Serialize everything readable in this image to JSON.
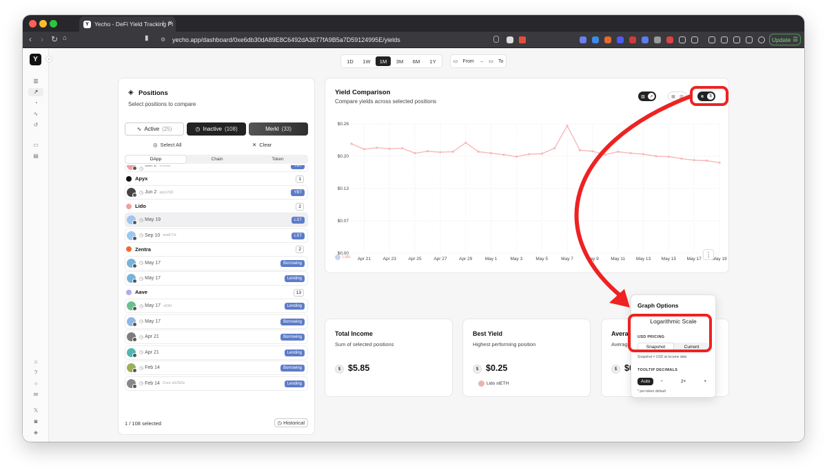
{
  "browser": {
    "tab_title": "Yecho - DeFi Yield Tracking Pl",
    "url": "yecho.app/dashboard/0xe6db30dA89E8C6492dA3677fA9B5a7D59124995E/yields",
    "update_label": "Update",
    "favicon_letter": "Y"
  },
  "app": {
    "logo_letter": "Y"
  },
  "range": {
    "options": [
      "1D",
      "1W",
      "1M",
      "3M",
      "6M",
      "1Y"
    ],
    "selected": "1M",
    "from_label": "From",
    "arrow": "→",
    "to_label": "To"
  },
  "positions": {
    "title": "Positions",
    "subtitle": "Select positions to compare",
    "filters": [
      {
        "label": "Active",
        "count": "(25)"
      },
      {
        "label": "Inactive",
        "count": "(108)"
      },
      {
        "label": "Merkl",
        "count": "(33)"
      }
    ],
    "select_all": "Select All",
    "clear": "Clear",
    "tabs": [
      "DApp",
      "Chain",
      "Token"
    ],
    "partial_row": {
      "date": "Jun 2",
      "sub": "susdai",
      "badge": "YBT"
    },
    "groups": [
      {
        "name": "Apyx",
        "count": "1",
        "color": "#111111",
        "rows": [
          {
            "date": "Jun 2",
            "sub": "apyUSD",
            "badge": "YBT",
            "token_color": "#444444"
          }
        ]
      },
      {
        "name": "Lido",
        "count": "2",
        "color": "#f0a0a0",
        "rows": [
          {
            "date": "May 19",
            "sub": "",
            "badge": "LST",
            "token_color": "#9ec7ee",
            "selected": true
          },
          {
            "date": "Sep 10",
            "sub": "wstETH",
            "badge": "LST",
            "token_color": "#9ec7ee"
          }
        ]
      },
      {
        "name": "Zentra",
        "count": "2",
        "color": "#f26b2b",
        "rows": [
          {
            "date": "May 17",
            "sub": "",
            "badge": "Borrowing",
            "token_color": "#7ab3d9"
          },
          {
            "date": "May 17",
            "sub": "",
            "badge": "Lending",
            "token_color": "#7ab3d9"
          }
        ]
      },
      {
        "name": "Aave",
        "count": "13",
        "color": "#b6a9e8",
        "rows": [
          {
            "date": "May 17",
            "sub": "sDAI",
            "badge": "Lending",
            "token_color": "#6cc08b"
          },
          {
            "date": "May 17",
            "sub": "",
            "badge": "Borrowing",
            "token_color": "#8fb7e6"
          },
          {
            "date": "Apr 21",
            "sub": "",
            "badge": "Borrowing",
            "token_color": "#7d7d7d"
          },
          {
            "date": "Apr 21",
            "sub": "",
            "badge": "Lending",
            "token_color": "#4fb8b0"
          },
          {
            "date": "Feb 14",
            "sub": "",
            "badge": "Borrowing",
            "token_color": "#9bb05a"
          },
          {
            "date": "Feb 14",
            "sub": "Core stUSDe",
            "badge": "Lending",
            "token_color": "#888888"
          }
        ]
      }
    ],
    "footer_selected": "1 / 108 selected",
    "footer_historical": "Historical"
  },
  "chart": {
    "title": "Yield Comparison",
    "subtitle": "Compare yields across selected positions",
    "legend_label": "Lido",
    "color": "#f7b8b8"
  },
  "chart_data": {
    "type": "line",
    "yticks": [
      "$0.26",
      "$0.20",
      "$0.13",
      "$0.07",
      "$0.00"
    ],
    "ylim": [
      0,
      0.26
    ],
    "xticks": [
      "Apr 21",
      "Apr 23",
      "Apr 25",
      "Apr 27",
      "Apr 29",
      "May 1",
      "May 3",
      "May 5",
      "May 7",
      "May 9",
      "May 11",
      "May 13",
      "May 15",
      "May 17",
      "May 19"
    ],
    "grid": true,
    "series": [
      {
        "name": "Lido",
        "x": [
          "Apr 20",
          "Apr 21",
          "Apr 22",
          "Apr 23",
          "Apr 24",
          "Apr 25",
          "Apr 26",
          "Apr 27",
          "Apr 28",
          "Apr 29",
          "Apr 30",
          "May 1",
          "May 2",
          "May 3",
          "May 4",
          "May 5",
          "May 6",
          "May 7",
          "May 8",
          "May 9",
          "May 10",
          "May 11",
          "May 12",
          "May 13",
          "May 14",
          "May 15",
          "May 16",
          "May 17",
          "May 18",
          "May 19"
        ],
        "values": [
          0.22,
          0.209,
          0.212,
          0.21,
          0.211,
          0.201,
          0.205,
          0.203,
          0.204,
          0.222,
          0.204,
          0.201,
          0.198,
          0.194,
          0.199,
          0.2,
          0.211,
          0.256,
          0.207,
          0.205,
          0.198,
          0.204,
          0.201,
          0.199,
          0.195,
          0.194,
          0.19,
          0.187,
          0.186,
          0.182
        ]
      }
    ]
  },
  "stats": [
    {
      "title": "Total Income",
      "subtitle": "Sum of selected positions",
      "value": "$5.85",
      "footer": ""
    },
    {
      "title": "Best Yield",
      "subtitle": "Highest performing position",
      "value": "$0.25",
      "footer": "Lido stETH"
    },
    {
      "title": "Avera",
      "subtitle": "Averag",
      "value": "$0",
      "footer": ""
    }
  ],
  "graph_options": {
    "title": "Graph Options",
    "log_scale": "Logarithmic Scale",
    "usd_pricing_label": "USD PRICING",
    "pricing_options": [
      "Snapshot",
      "Current"
    ],
    "pricing_selected": "Snapshot",
    "pricing_note": "Snapshot = USD at income date",
    "decimals_label": "TOOLTIP DECIMALS",
    "decimals_auto": "Auto",
    "decimals_minus": "−",
    "decimals_value": "2+",
    "decimals_plus": "+",
    "decimals_hint": "* per-token default"
  },
  "icons": {
    "positions": "layers-icon",
    "active": "activity-icon",
    "inactive": "clock-icon",
    "select_all": "check-circle-icon",
    "clear": "x-icon",
    "dollar": "dollar-icon",
    "more": "more-vertical-icon"
  },
  "annotation_color": "#ee2222"
}
